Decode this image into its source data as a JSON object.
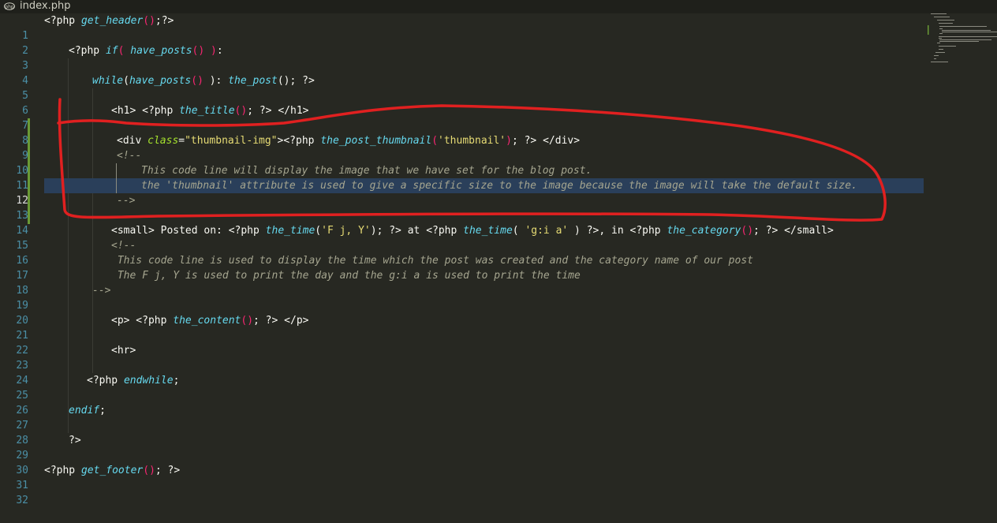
{
  "tab": {
    "title": "index.php",
    "icon": "php-file-icon"
  },
  "colors": {
    "background": "#272822",
    "line_numbers": "#4b8fa6",
    "highlight": "#2a3f5a",
    "annotation": "#e02020",
    "change_bar": "#6a9a35"
  },
  "editor": {
    "selected_line": 12,
    "lines": [
      {
        "n": "1"
      },
      {
        "n": "2"
      },
      {
        "n": "3"
      },
      {
        "n": "4"
      },
      {
        "n": "5"
      },
      {
        "n": "6"
      },
      {
        "n": "7"
      },
      {
        "n": "8"
      },
      {
        "n": "9"
      },
      {
        "n": "10"
      },
      {
        "n": "11"
      },
      {
        "n": "12"
      },
      {
        "n": "13"
      },
      {
        "n": "14"
      },
      {
        "n": "15"
      },
      {
        "n": "16"
      },
      {
        "n": "17"
      },
      {
        "n": "18"
      },
      {
        "n": "19"
      },
      {
        "n": "20"
      },
      {
        "n": "21"
      },
      {
        "n": "22"
      },
      {
        "n": "23"
      },
      {
        "n": "24"
      },
      {
        "n": "25"
      },
      {
        "n": "26"
      },
      {
        "n": "27"
      },
      {
        "n": "28"
      },
      {
        "n": "29"
      },
      {
        "n": "30"
      },
      {
        "n": "31"
      },
      {
        "n": "32"
      }
    ],
    "code": {
      "l1_a": "<?php ",
      "l1_fn": "get_header",
      "l1_p": "()",
      "l1_b": ";?>",
      "l3_a": "<?php ",
      "l3_kw": "if",
      "l3_p1": "(",
      "l3_fn": " have_posts",
      "l3_p2": "()",
      "l3_p3": " )",
      "l3_b": ":",
      "l5_kw": "while",
      "l5_b1": "(",
      "l5_fn": "have_posts",
      "l5_p": "()",
      "l5_b2": " ): ",
      "l5_fn2": "the_post",
      "l5_b3": "(); ?>",
      "l7_a": "<h1> <?php ",
      "l7_fn": "the_title",
      "l7_p": "()",
      "l7_b": "; ?> </h1>",
      "l9_a": "<div ",
      "l9_attr": "class",
      "l9_eq": "=",
      "l9_str": "\"thumbnail-img\"",
      "l9_b": "><?php ",
      "l9_fn": "the_post_thumbnail",
      "l9_p1": "(",
      "l9_str2": "'thumbnail'",
      "l9_p2": ")",
      "l9_c": "; ?> </div>",
      "l10": "<!--",
      "l11": "This code line will display the image that we have set for the blog post.",
      "l12": "the 'thumbnail' attribute is used to give a specific size to the image because the image will take the default size.",
      "l13": "-->",
      "l15_a": "<small> Posted on: <?php ",
      "l15_fn": "the_time",
      "l15_b": "(",
      "l15_str": "'F j, Y'",
      "l15_c": "); ?> at <?php ",
      "l15_fn2": "the_time",
      "l15_d": "( ",
      "l15_str2": "'g:i a'",
      "l15_e": " ) ?>, in <?php ",
      "l15_fn3": "the_category",
      "l15_p": "()",
      "l15_f": "; ?> </small>",
      "l16": "<!--",
      "l17": " This code line is used to display the time which the post was created and the category name of our post",
      "l18": " The F j, Y is used to print the day and the g:i a is used to print the time",
      "l19": "-->",
      "l21_a": "<p> <?php ",
      "l21_fn": "the_content",
      "l21_p": "()",
      "l21_b": "; ?> </p>",
      "l23": "<hr>",
      "l25_a": "<?php ",
      "l25_kw": "endwhile",
      "l25_b": ";",
      "l27_kw": "endif",
      "l27_b": ";",
      "l29": "?>",
      "l31_a": "<?php ",
      "l31_fn": "get_footer",
      "l31_p": "()",
      "l31_b": "; ?>"
    }
  }
}
